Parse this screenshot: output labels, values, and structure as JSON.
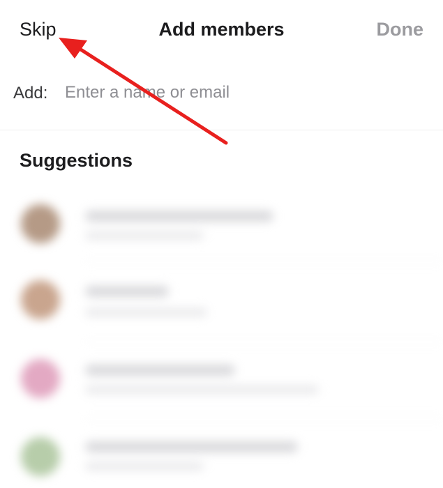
{
  "nav": {
    "skip_label": "Skip",
    "title": "Add members",
    "done_label": "Done"
  },
  "add": {
    "label": "Add:",
    "placeholder": "Enter a name or email"
  },
  "suggestions": {
    "header": "Suggestions"
  },
  "colors": {
    "text_primary": "#1c1c1e",
    "text_disabled": "#9b9b9f",
    "placeholder": "#8e8e93",
    "annotation_arrow": "#e8201e"
  },
  "icons": {
    "annotation": "red-arrow-icon"
  }
}
